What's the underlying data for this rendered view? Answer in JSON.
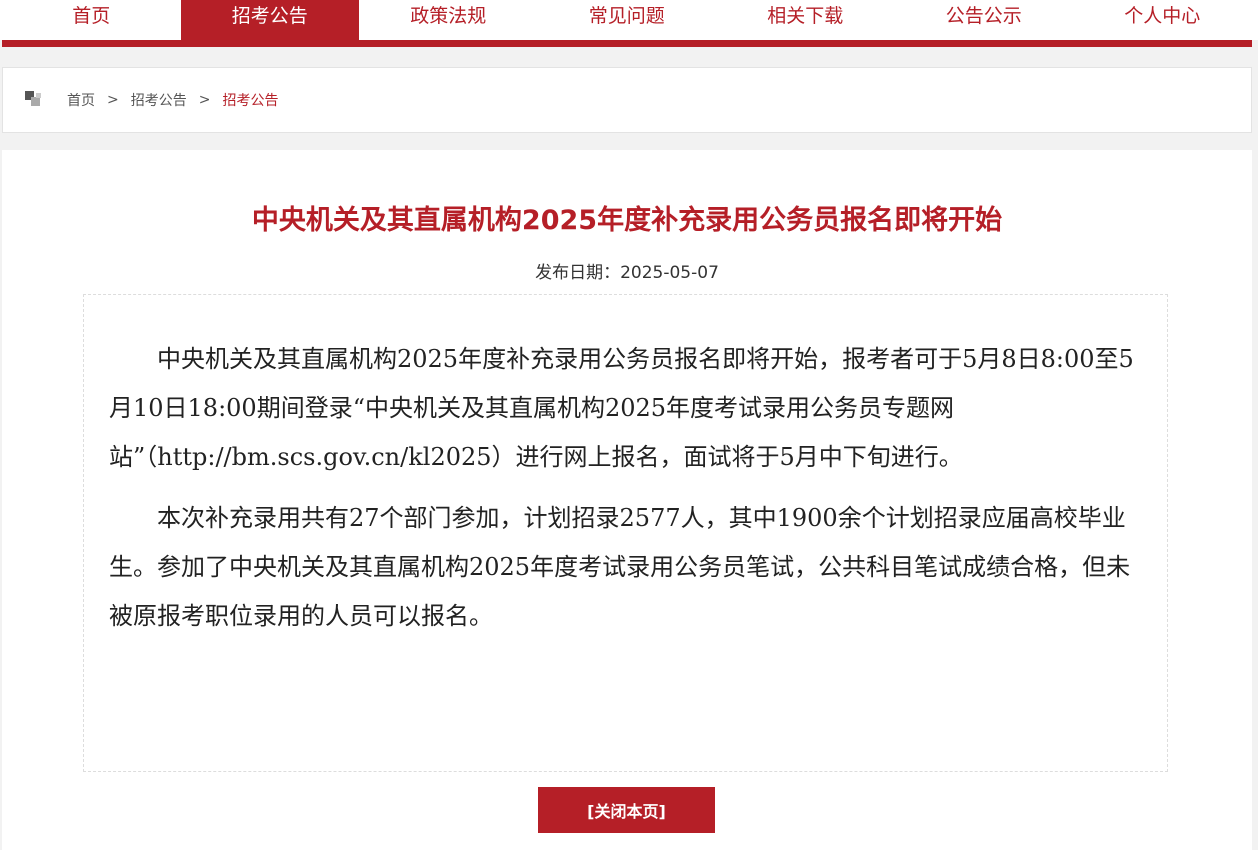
{
  "nav": {
    "items": [
      {
        "label": "首页"
      },
      {
        "label": "招考公告"
      },
      {
        "label": "政策法规"
      },
      {
        "label": "常见问题"
      },
      {
        "label": "相关下载"
      },
      {
        "label": "公告公示"
      },
      {
        "label": "个人中心"
      }
    ],
    "active_index": 1
  },
  "breadcrumb": {
    "home": "首页",
    "section": "招考公告",
    "current": "招考公告",
    "separator": ">"
  },
  "article": {
    "title": "中央机关及其直属机构2025年度补充录用公务员报名即将开始",
    "date_label": "发布日期：",
    "date_value": "2025-05-07",
    "paragraphs": [
      "中央机关及其直属机构2025年度补充录用公务员报名即将开始，报考者可于5月8日8:00至5月10日18:00期间登录“中央机关及其直属机构2025年度考试录用公务员专题网站”（http://bm.scs.gov.cn/kl2025）进行网上报名，面试将于5月中下旬进行。",
      "本次补充录用共有27个部门参加，计划招录2577人，其中1900余个计划招录应届高校毕业生。参加了中央机关及其直属机构2025年度考试录用公务员笔试，公共科目笔试成绩合格，但未被原报考职位录用的人员可以报名。"
    ]
  },
  "close_button": {
    "label": "[关闭本页]"
  },
  "colors": {
    "accent": "#b51f27",
    "page_background": "#f2f2f2"
  }
}
